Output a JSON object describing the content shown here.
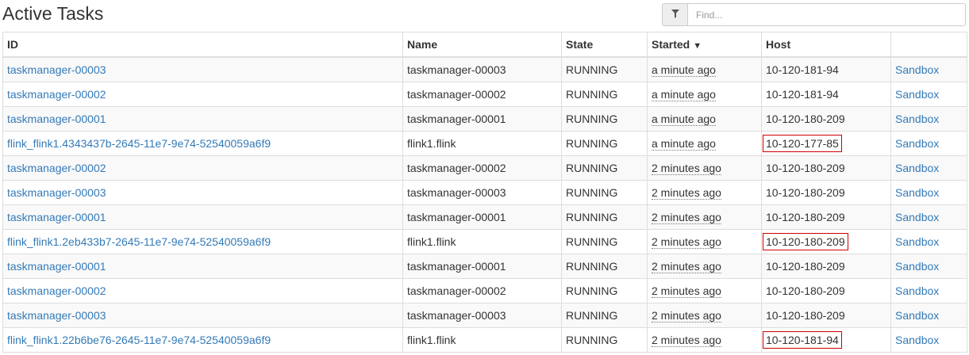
{
  "page": {
    "title": "Active Tasks"
  },
  "search": {
    "placeholder": "Find..."
  },
  "table": {
    "headers": {
      "id": "ID",
      "name": "Name",
      "state": "State",
      "started": "Started",
      "started_sort_indicator": "▼",
      "host": "Host",
      "actions": ""
    },
    "rows": [
      {
        "id": "taskmanager-00003",
        "name": "taskmanager-00003",
        "state": "RUNNING",
        "started": "a minute ago",
        "host": "10-120-181-94",
        "action": "Sandbox",
        "host_highlighted": false
      },
      {
        "id": "taskmanager-00002",
        "name": "taskmanager-00002",
        "state": "RUNNING",
        "started": "a minute ago",
        "host": "10-120-181-94",
        "action": "Sandbox",
        "host_highlighted": false
      },
      {
        "id": "taskmanager-00001",
        "name": "taskmanager-00001",
        "state": "RUNNING",
        "started": "a minute ago",
        "host": "10-120-180-209",
        "action": "Sandbox",
        "host_highlighted": false
      },
      {
        "id": "flink_flink1.4343437b-2645-11e7-9e74-52540059a6f9",
        "name": "flink1.flink",
        "state": "RUNNING",
        "started": "a minute ago",
        "host": "10-120-177-85",
        "action": "Sandbox",
        "host_highlighted": true
      },
      {
        "id": "taskmanager-00002",
        "name": "taskmanager-00002",
        "state": "RUNNING",
        "started": "2 minutes ago",
        "host": "10-120-180-209",
        "action": "Sandbox",
        "host_highlighted": false
      },
      {
        "id": "taskmanager-00003",
        "name": "taskmanager-00003",
        "state": "RUNNING",
        "started": "2 minutes ago",
        "host": "10-120-180-209",
        "action": "Sandbox",
        "host_highlighted": false
      },
      {
        "id": "taskmanager-00001",
        "name": "taskmanager-00001",
        "state": "RUNNING",
        "started": "2 minutes ago",
        "host": "10-120-180-209",
        "action": "Sandbox",
        "host_highlighted": false
      },
      {
        "id": "flink_flink1.2eb433b7-2645-11e7-9e74-52540059a6f9",
        "name": "flink1.flink",
        "state": "RUNNING",
        "started": "2 minutes ago",
        "host": "10-120-180-209",
        "action": "Sandbox",
        "host_highlighted": true
      },
      {
        "id": "taskmanager-00001",
        "name": "taskmanager-00001",
        "state": "RUNNING",
        "started": "2 minutes ago",
        "host": "10-120-180-209",
        "action": "Sandbox",
        "host_highlighted": false
      },
      {
        "id": "taskmanager-00002",
        "name": "taskmanager-00002",
        "state": "RUNNING",
        "started": "2 minutes ago",
        "host": "10-120-180-209",
        "action": "Sandbox",
        "host_highlighted": false
      },
      {
        "id": "taskmanager-00003",
        "name": "taskmanager-00003",
        "state": "RUNNING",
        "started": "2 minutes ago",
        "host": "10-120-180-209",
        "action": "Sandbox",
        "host_highlighted": false
      },
      {
        "id": "flink_flink1.22b6be76-2645-11e7-9e74-52540059a6f9",
        "name": "flink1.flink",
        "state": "RUNNING",
        "started": "2 minutes ago",
        "host": "10-120-181-94",
        "action": "Sandbox",
        "host_highlighted": true
      }
    ]
  },
  "icons": {
    "filter": "filter-icon"
  },
  "colors": {
    "link": "#337ab7",
    "highlight_border": "#cc0000",
    "stripe": "#f9f9f9",
    "border": "#dddddd"
  }
}
